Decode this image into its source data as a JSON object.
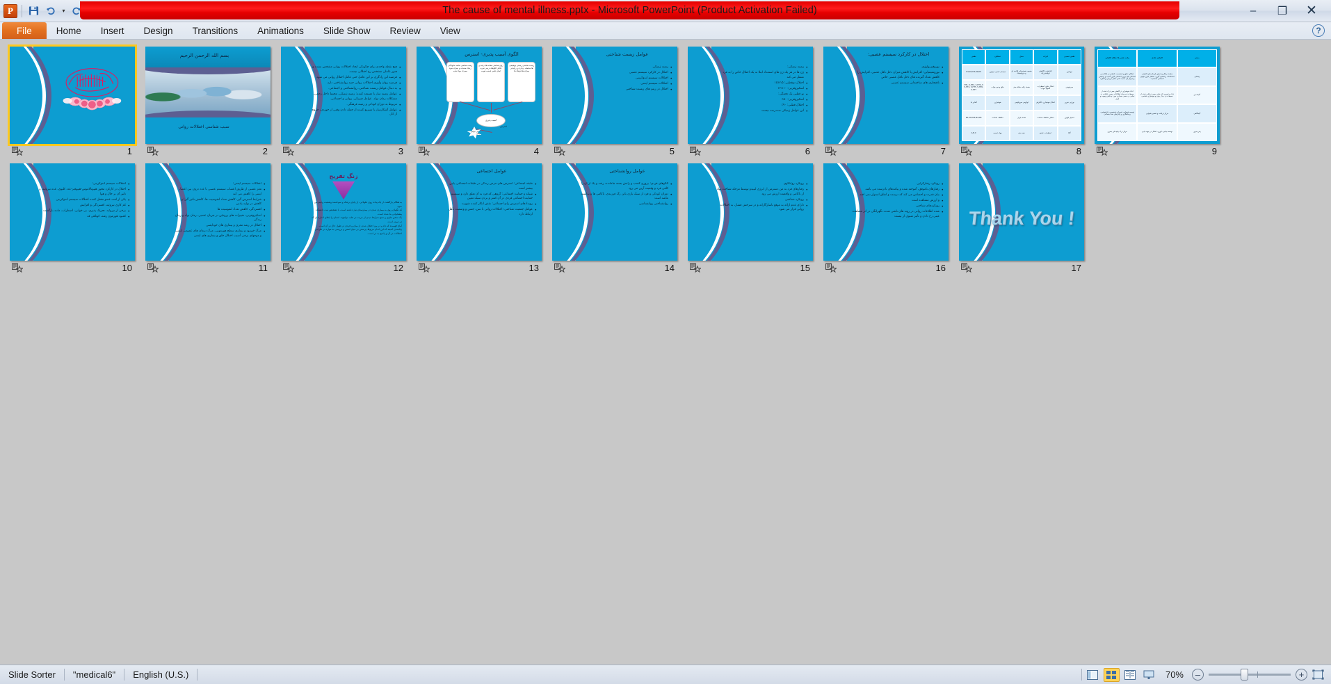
{
  "window": {
    "title": "The cause of mental illness.pptx  -  Microsoft PowerPoint (Product Activation Failed)",
    "minimize_label": "–",
    "restore_label": "❐",
    "close_label": "✕"
  },
  "quick_access": {
    "app_logo": "powerpoint-logo",
    "save_label": "💾",
    "undo_label": "↺",
    "undo_dropdown_label": "▾",
    "redo_label": "↻",
    "customize_label": "▾"
  },
  "ribbon": {
    "help_label": "?",
    "tabs": [
      {
        "label": "File",
        "active": true
      },
      {
        "label": "Home",
        "active": false
      },
      {
        "label": "Insert",
        "active": false
      },
      {
        "label": "Design",
        "active": false
      },
      {
        "label": "Transitions",
        "active": false
      },
      {
        "label": "Animations",
        "active": false
      },
      {
        "label": "Slide Show",
        "active": false
      },
      {
        "label": "Review",
        "active": false
      },
      {
        "label": "View",
        "active": false
      }
    ]
  },
  "statusbar": {
    "view_name": "Slide Sorter",
    "theme_name": "\"medical6\"",
    "language": "English (U.S.)",
    "zoom_level": "70%",
    "zoom_out_label": "–",
    "zoom_in_label": "+",
    "views": [
      {
        "name": "normal-view-button",
        "active": false
      },
      {
        "name": "slide-sorter-view-button",
        "active": true
      },
      {
        "name": "reading-view-button",
        "active": false
      },
      {
        "name": "slide-show-view-button",
        "active": false
      }
    ],
    "fit_button_label": "fit-slide-to-window"
  },
  "slides": [
    {
      "number": "1",
      "selected": true,
      "kind": "bismillah",
      "title": "",
      "footer": ""
    },
    {
      "number": "2",
      "selected": false,
      "kind": "title-photo",
      "heading": "بسم الله الرحمن الرحیم",
      "subheading": "سبب شناسی اختلالات روانی"
    },
    {
      "number": "3",
      "selected": false,
      "kind": "bullets",
      "title": "",
      "bullets": [
        "هیچ نقطه واحدی برای چگونگی ایجاد اختلالات روانی مشخص نشده و هنوز عاملی مشخص رخ اختلالی نیست.",
        "فرضیه این زادگری بر این عامل حتی عامل اختلال روانی می شود.",
        "فرضیه روان وآوری اختلالات روانی جنبه روانشناختی دارد.",
        "به دنبال عوامل زیست شناختی، روانشناختی و اجتماعی.",
        "عوامل زمینه ساز یا مستعد کننده: زمینه ژنتیکی، محیط داخل رحمی، مشکلات زمان تولد، عوامل فیزیکی، روانی و اجتماعی.",
        "مربوط به دوران کودکی و زمینه فرهنگی.",
        "عوامل آشکارساز یا تسریع کننده از جمله دادن وقتی از خوردن، خروج از کار."
      ],
      "footer": ""
    },
    {
      "number": "4",
      "selected": false,
      "kind": "diagram",
      "title": "الگوی آسیب پذیری- استرس",
      "boxes": [
        "زیست شناسی\nسابقه خانوادگی\nژنتیک\nصدمات و بیماری\nسوء مصرف مواد\nتغذیه",
        "روان شناختی\nنشانه های رشد و تکامل\nالگوهای تربیتی تجربه\nایمان علمی\nاسنیت هویت",
        "زیست شناختی\nزیستی\nبیوشیمی ها\nحفاظت بردباری و روانپذیر\nبیماری ها\nفرهنگ ها"
      ],
      "center": "آسیب پذیری",
      "star": "استرس\nعوامل محیطی",
      "label": "استرس"
    },
    {
      "number": "5",
      "selected": false,
      "kind": "bullets",
      "title": "عوامل زیست شناختی",
      "bullets": [
        "زمینه ژنتیکی",
        "اختلال در کارکرد سیستم عصبی",
        "اختلالات سیستم اندوکرینی",
        "اختلالات سیستم ایمنی",
        "اختلال در ریتم های زیست شناختی"
      ],
      "footer": ""
    },
    {
      "number": "6",
      "selected": false,
      "kind": "bullets",
      "title": "",
      "bullets": [
        "زمینه ژنتیکی:",
        "ژن ها در هر یک ژن های استعداد ابتلا به یک اختلال خاص را به فرد منتقل می کند",
        "اختلال دوقطبی: ۱۵×۱۵",
        "اسکیزوفرنی: ۱۰×۱۲",
        "نو قطبی یک تخمگی:",
        "اسکیزوفرنی: ۵۰٪",
        "اختلال قطبی: ۹۰٪",
        "این عوامل ژنتیکی صددرصد نیست"
      ],
      "footer": ""
    },
    {
      "number": "7",
      "selected": false,
      "kind": "bullets",
      "title": "اختلال در کارکرد سیستم عصبی:",
      "bullets": [
        "نوروفیزیولوژی",
        "نوروشیمیایی: افزایش یا کاهش میزان دخل ناقل عصبی، افزایش را کاهش تعداد گیرنده های دخل ناقل عصبی خاص",
        "ناهنجاری های ساختمانی سیستم عصبی"
      ],
      "footer": ""
    },
    {
      "number": "8",
      "selected": false,
      "kind": "table",
      "table": {
        "headers": [
          "نقش عصبی",
          "اثرات",
          "محل",
          "عملکرد",
          "نقش"
        ],
        "rows": [
          [
            "دوپامین",
            "افزایش یا کاهش دوپامینرژیک",
            "مخچه، هسته های قاعده ای و مزولیمبیک",
            "سیستم عصبی مرکزی",
            "D1,D2,D3,D4,D5"
          ],
          [
            "سروتونین",
            "اختلال خلق، اضطراب، اشتها، خواب",
            "هسته رافه، ساقه مغز",
            "خلق و خو، خواب",
            "5-HT1, 5-HT2,\n5-HT3, 5-HT4,\n5-HT5, 5-HT6,\n5-HT7"
          ],
          [
            "نوراپی نفرین",
            "اختلال هوشیاری، انگیزش",
            "لوکوس سرولئوس",
            "هوشیاری",
            "آلفا و بتا"
          ],
          [
            "استیل کولین",
            "اختلال حافظه، شناخت",
            "هسته بازال",
            "حافظه، شناخت",
            "M1,M2,M3,M4,M5"
          ],
          [
            "گابا",
            "اضطراب، تشنج",
            "همه مغز",
            "مهار عصبی",
            "A,B,C"
          ]
        ]
      }
    },
    {
      "number": "9",
      "selected": false,
      "kind": "table",
      "table": {
        "headers": [
          "بخش",
          "کارکرد عادی",
          "پیامد نقص یا اختلال کارکرد"
        ],
        "rows": [
          [
            "پیشانی",
            "سازنده رفتار و اجرای فرمان های کنترلی، احساسات و تصمیم گیری، احتمال کاری هوش، احساس شخصیت",
            "عملکرد خلق و شخصیت، ناتوانی در فعالیت و احساس کم نیروی احساس کاری آسیب و پیدایش و تمرکز آن، نسبت دادن تفکر تدریجی و انگیزه"
          ],
          [
            "آهیانه ای",
            "درک و تفسیر داده های حسی دریافت شده از محیط بدن، بیدار بودن و هوشیاری شناسی",
            "اندک هوشیاری در کاهش حس درک شده از محیط بدن و بیدار اطلاعات حسی، ناتوانی در تماس بی حسی بسیاری مورد پیدایش وجهت و قرار"
          ],
          [
            "گیجگاهی",
            "مرکز دریافت و تفسیر شنوایی",
            "توسعه شنوایی، تغییرات شخصیت، فراموشی، پرخاشگری و رفتارهای ضد اجتماعی"
          ],
          [
            "پس سری",
            "توسعه بینایی، کوری، اختلال در جهت یابی",
            "مرکز درک پیام های بصری"
          ]
        ]
      }
    },
    {
      "number": "10",
      "selected": false,
      "kind": "bullets",
      "title": "",
      "bullets": [
        "اختلالات سیستم اندوکرینی:",
        "اختلال در کارکرد محور هیپوتالاموس-هیپوفیز-غدد کلیوی، غده تیروئید، و تاثیر آن بر حال و هوا",
        "یکی از افت عضو مختل کننده اختلالات سیستم اندوکرینی",
        "کم کاری تیروئید، افسردگی و افزایش",
        "برخی از تیروئید، تحریک پذیری، بی خوابی، اضطراب، مانند بازگشت",
        "کمبود هورمون رشد، کوتاهی قد"
      ],
      "footer": ""
    },
    {
      "number": "11",
      "selected": false,
      "kind": "bullets",
      "title": "",
      "bullets": [
        "اختلالات سیستم ایمنی:",
        "مغز عصبی از طریق اعصاب سیستم عصبی با عدد درون بین اعضا، ایمنی را کاهش می کند",
        "شرایط استرس گیر، کاهش تعداد لنفوسیت ها، کاهش تاثیر گیرا و کاهش در تولید پادتن",
        "افسردگی، کاهش تعداد لنفوسیت ها",
        "اسکیزوفرنی، تغییرات های پروتئین در جریان عصبی، زمان تولد و زمان زندگی",
        "اختلال در رشد مغزی و بیماری های خودایمنی",
        "مرگ خونبود و بیماری سطح هورمونی، مرگ درمان های عمومی ایمنی و موجهای برخی آسیب اختلال خلق و بیماری های ایمنی"
      ],
      "footer": ""
    },
    {
      "number": "12",
      "selected": false,
      "kind": "break",
      "title": "زنگ تفریح",
      "body": [
        "به هنگام بازگشت از یک پیاده روی طولانی، از پایان پزشک و سوختمند وضعیت وخیم می شود.",
        "که نگهبان روی به بیماری شدن در بیمارستان نیاز داشته است، با تشخیص ثبت دانشگاه پیشخوانی بنا شده است.",
        "یک سخن جلوی و جمع شرایط دیدن از مزیت در طب مواجهد، انسان را ابتلای اندازه ای که در درون است.",
        "آماج فهمیده که داد و در بین اختلال شدن از میان و فردی در طول حال در آن است.",
        "پایانبندی کمیته که این اندام مربوط پرسش در میان لمس و بررسی به موارد در طراحی اختلالات در آن و پاسخ به در است."
      ]
    },
    {
      "number": "13",
      "selected": false,
      "kind": "bullets",
      "title": "عوامل اجتماعی",
      "bullets": [
        "طبقه اجتماعی: استرس های مزمن زندگی در طبقات اجتماعی پایین بیشتر است",
        "شبکه و حمایت اجتماعی: گروهی که فرد به آن تعلق دارد و سیستم حمایت اجتماعی فردی در آن کمتر و بردن سبک تعیین",
        "رویدادهای استرس زای اجتماعی: نقش انکار کننده شهرت",
        "عوامل جمعیت شناختی: اختلالات روانی با سن، جنس و وضعیت تأهل ارتباط دارد"
      ],
      "footer": ""
    },
    {
      "number": "14",
      "selected": false,
      "kind": "bullets",
      "title": "عوامل روانشناختی",
      "bullets": [
        "الگوهای فردی: بروزی کسب و رانش بسته جامانده، رشد و یک از آن را کافی فرد و وقعیت آرین می رود",
        "دوران کودکی و فرد از سبک بازی باتن رگ فرزندی، ناکامی ها و نداشته ماشد است",
        "روانشناختی روانشناسی"
      ],
      "footer": ""
    },
    {
      "number": "15",
      "selected": false,
      "kind": "bullets",
      "title": "",
      "bullets": [
        "رویکرد روانکاوی",
        "رفتارهای فرد به من دسترس از انرژی لیبیدو توسط مرحله شناخت نهاد از ناکامی و واقعیت ارزش می رود",
        "رویکرد شناختی",
        "دارای عدم ارائه به موقع ناسازگارانه و در سرخش فشار، به اختلالات روانی قرار می شود"
      ],
      "footer": ""
    },
    {
      "number": "16",
      "selected": false,
      "kind": "bullets",
      "title": "",
      "bullets": [
        "رویکرد رفتارگرایی",
        "رفتارهای ناموفق، آموخته شده و پیامدهای نادرست می باشد",
        "بیان قدرت و احساس می کند که درست و اتفاق استوار نمی افتد",
        "و ارزش مشاهده است",
        "رویکردهای شناختی",
        "شده اطلاعات روانی در روند های ناشی شده، نگهرانگی در اثر مشاهده عینی رخ دادن و تأثیر شنوی از نیست"
      ],
      "footer": ""
    },
    {
      "number": "17",
      "selected": false,
      "kind": "thankyou",
      "text": "Thank You !"
    }
  ]
}
